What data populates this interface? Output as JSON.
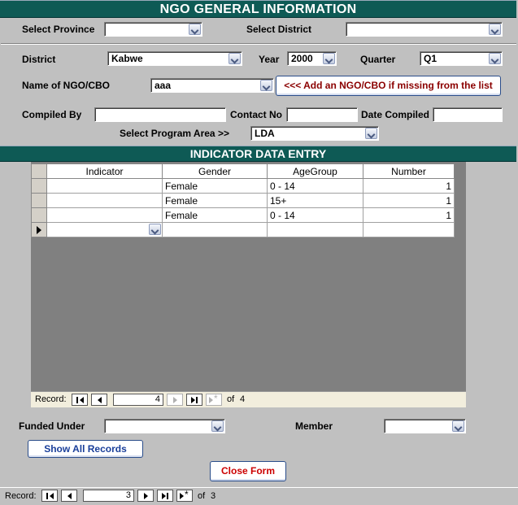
{
  "header": {
    "title": "NGO GENERAL INFORMATION"
  },
  "filter": {
    "province_label": "Select Province",
    "province_value": "",
    "district_label": "Select District",
    "district_value": ""
  },
  "form": {
    "district_label": "District",
    "district_value": "Kabwe",
    "year_label": "Year",
    "year_value": "2000",
    "quarter_label": "Quarter",
    "quarter_value": "Q1",
    "ngo_label": "Name of NGO/CBO",
    "ngo_value": "aaa",
    "add_ngo_button": "<<< Add an NGO/CBO if missing from the list",
    "compiled_by_label": "Compiled By",
    "compiled_by_value": "",
    "contact_label": "Contact No",
    "contact_value": "",
    "date_label": "Date Compiled",
    "date_value": "",
    "program_label": "Select Program Area >>",
    "program_value": "LDA"
  },
  "indicator_section": {
    "title": "INDICATOR DATA ENTRY"
  },
  "table": {
    "columns": [
      "Indicator",
      "Gender",
      "AgeGroup",
      "Number"
    ],
    "rows": [
      {
        "indicator": "",
        "gender": "Female",
        "age": "0 - 14",
        "number": "1"
      },
      {
        "indicator": "",
        "gender": "Female",
        "age": "15+",
        "number": "1"
      },
      {
        "indicator": "",
        "gender": "Female",
        "age": "0 - 14",
        "number": "1"
      }
    ]
  },
  "sub_nav": {
    "label": "Record:",
    "current": "4",
    "of_label": "of",
    "total": "4"
  },
  "footer_form": {
    "funded_label": "Funded Under",
    "funded_value": "",
    "member_label": "Member",
    "member_value": "",
    "show_all_button": "Show All Records",
    "close_button": "Close Form"
  },
  "main_nav": {
    "label": "Record:",
    "current": "3",
    "of_label": "of",
    "total": "3"
  },
  "colors": {
    "title_bar": "#0e5a55",
    "close_text": "#cc0000",
    "add_text": "#8b0000",
    "show_all_text": "#1a3f9a"
  }
}
